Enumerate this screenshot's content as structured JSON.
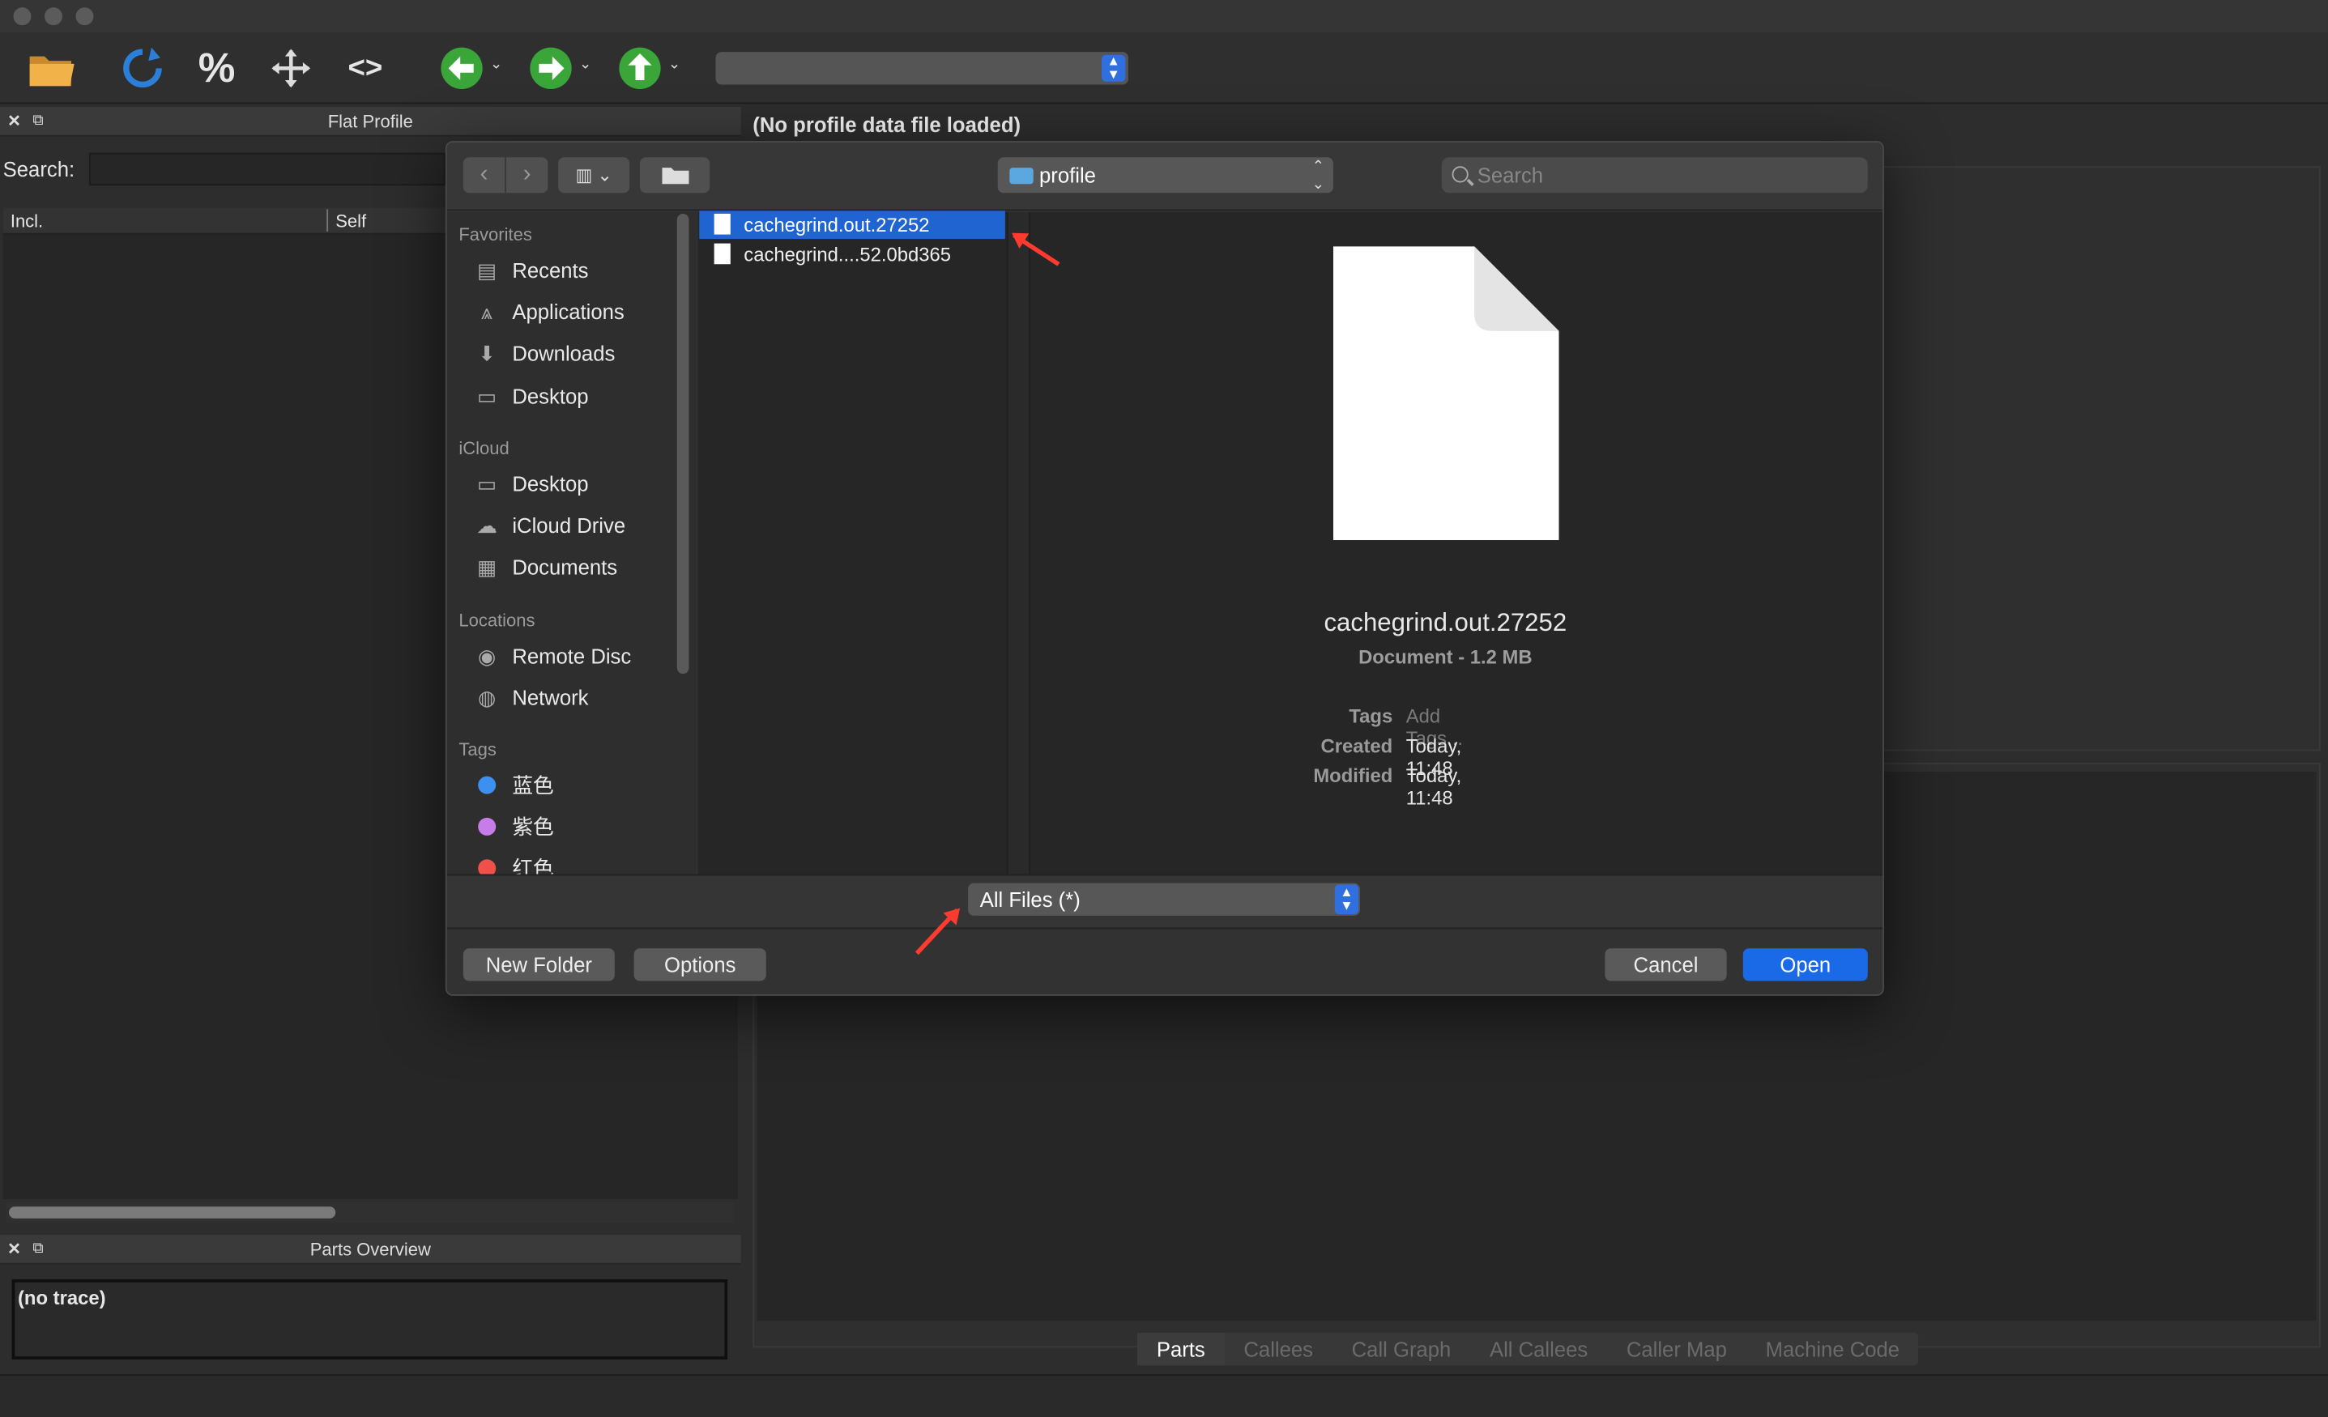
{
  "toolbar": {
    "icons": [
      "folder-open-icon",
      "reload-icon",
      "percent-icon",
      "move-icon",
      "code-icon",
      "back-icon",
      "forward-icon",
      "up-icon"
    ]
  },
  "left": {
    "flat_profile_title": "Flat Profile",
    "search_label": "Search:",
    "col_incl": "Incl.",
    "col_self": "Self",
    "parts_overview_title": "Parts Overview",
    "no_trace": "(no trace)"
  },
  "right": {
    "title": "(No profile data file loaded)",
    "tabs": [
      "Parts",
      "Callees",
      "Call Graph",
      "All Callees",
      "Caller Map",
      "Machine Code"
    ]
  },
  "dialog": {
    "location": "profile",
    "search_placeholder": "Search",
    "sidebar": {
      "favorites_head": "Favorites",
      "favorites": [
        "Recents",
        "Applications",
        "Downloads",
        "Desktop"
      ],
      "icloud_head": "iCloud",
      "icloud": [
        "Desktop",
        "iCloud Drive",
        "Documents"
      ],
      "locations_head": "Locations",
      "locations": [
        "Remote Disc",
        "Network"
      ],
      "tags_head": "Tags",
      "tags": [
        "蓝色",
        "紫色",
        "红色"
      ]
    },
    "files": [
      "cachegrind.out.27252",
      "cachegrind....52.0bd365"
    ],
    "preview": {
      "name": "cachegrind.out.27252",
      "kind": "Document - 1.2 MB",
      "tags_label": "Tags",
      "tags_value": "Add Tags...",
      "created_label": "Created",
      "created_value": "Today, 11:48",
      "modified_label": "Modified",
      "modified_value": "Today, 11:48"
    },
    "filter": "All Files (*)",
    "buttons": {
      "new_folder": "New Folder",
      "options": "Options",
      "cancel": "Cancel",
      "open": "Open"
    }
  },
  "colors": {
    "accent": "#1a6ae8",
    "selection": "#1f64d1",
    "tag_blue": "#3d8ff0",
    "tag_purple": "#c87ce8",
    "tag_red": "#f0504a",
    "annotation": "#ff3b30"
  }
}
